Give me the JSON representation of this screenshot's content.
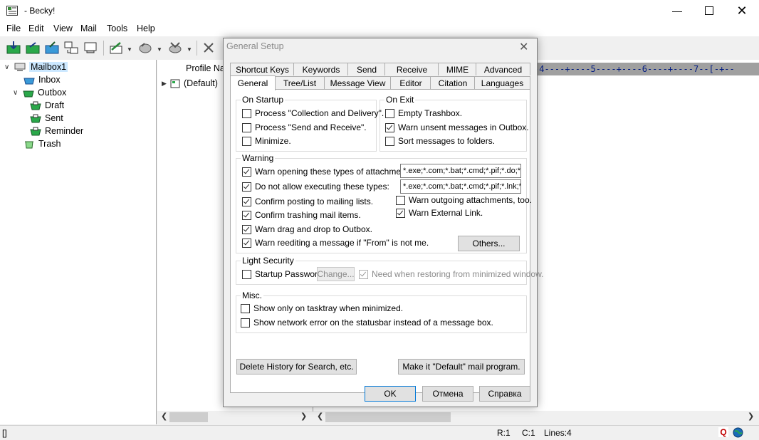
{
  "window": {
    "title": "- Becky!"
  },
  "menu": [
    "File",
    "Edit",
    "View",
    "Mail",
    "Tools",
    "Help"
  ],
  "tree": {
    "items": [
      {
        "label": "Mailbox1",
        "icon": "computer-icon"
      },
      {
        "label": "Inbox",
        "icon": "inbox-icon"
      },
      {
        "label": "Outbox",
        "icon": "outbox-icon"
      },
      {
        "label": "Draft",
        "icon": "folder-icon"
      },
      {
        "label": "Sent",
        "icon": "folder-icon"
      },
      {
        "label": "Reminder",
        "icon": "folder-icon"
      },
      {
        "label": "Trash",
        "icon": "trash-icon"
      }
    ]
  },
  "list": {
    "header": "Profile Na",
    "item": "(Default)"
  },
  "ruler": "-4----+----5----+----6----+----7--[-+--",
  "status": {
    "left": "[]",
    "row": "R:1",
    "col": "C:1",
    "lines": "Lines:4"
  },
  "dialog": {
    "title": "General Setup",
    "tabs_row1": [
      "Shortcut Keys",
      "Keywords",
      "Send",
      "Receive",
      "MIME",
      "Advanced"
    ],
    "tabs_row2": [
      "General",
      "Tree/List",
      "Message View",
      "Editor",
      "Citation",
      "Languages"
    ],
    "on_startup": {
      "title": "On Startup",
      "options": [
        {
          "label": "Process \"Collection and Delivery\".",
          "checked": false
        },
        {
          "label": "Process \"Send and Receive\".",
          "checked": false
        },
        {
          "label": "Minimize.",
          "checked": false
        }
      ]
    },
    "on_exit": {
      "title": "On Exit",
      "options": [
        {
          "label": "Empty Trashbox.",
          "checked": false
        },
        {
          "label": "Warn unsent messages in Outbox.",
          "checked": true
        },
        {
          "label": "Sort messages to folders.",
          "checked": false
        }
      ]
    },
    "warning": {
      "title": "Warning",
      "attach_label": "Warn opening these types of attachments:",
      "attach_value": "*.exe;*.com;*.bat;*.cmd;*.pif;*.do;*.x",
      "exec_label": "Do not allow executing these types:",
      "exec_value": "*.exe;*.com;*.bat;*.cmd;*.pif;*.lnk;*.",
      "confirm_mailing": "Confirm posting to mailing lists.",
      "confirm_trash": "Confirm trashing mail items.",
      "warn_drag": "Warn drag and drop to Outbox.",
      "warn_reedit": "Warn reediting a message if \"From\" is not me.",
      "warn_outgoing": "Warn outgoing attachments, too.",
      "warn_external": "Warn External Link.",
      "others": "Others..."
    },
    "light_security": {
      "title": "Light Security",
      "startup_password": "Startup Password",
      "change": "Change...",
      "need_restore": "Need when restoring from minimized window."
    },
    "misc": {
      "title": "Misc.",
      "tasktray": "Show only on tasktray when minimized.",
      "network_error": "Show network error on the statusbar instead of a message box."
    },
    "delete_history": "Delete History for Search, etc.",
    "make_default": "Make it \"Default\" mail program.",
    "ok": "OK",
    "cancel": "Отмена",
    "help": "Справка"
  }
}
